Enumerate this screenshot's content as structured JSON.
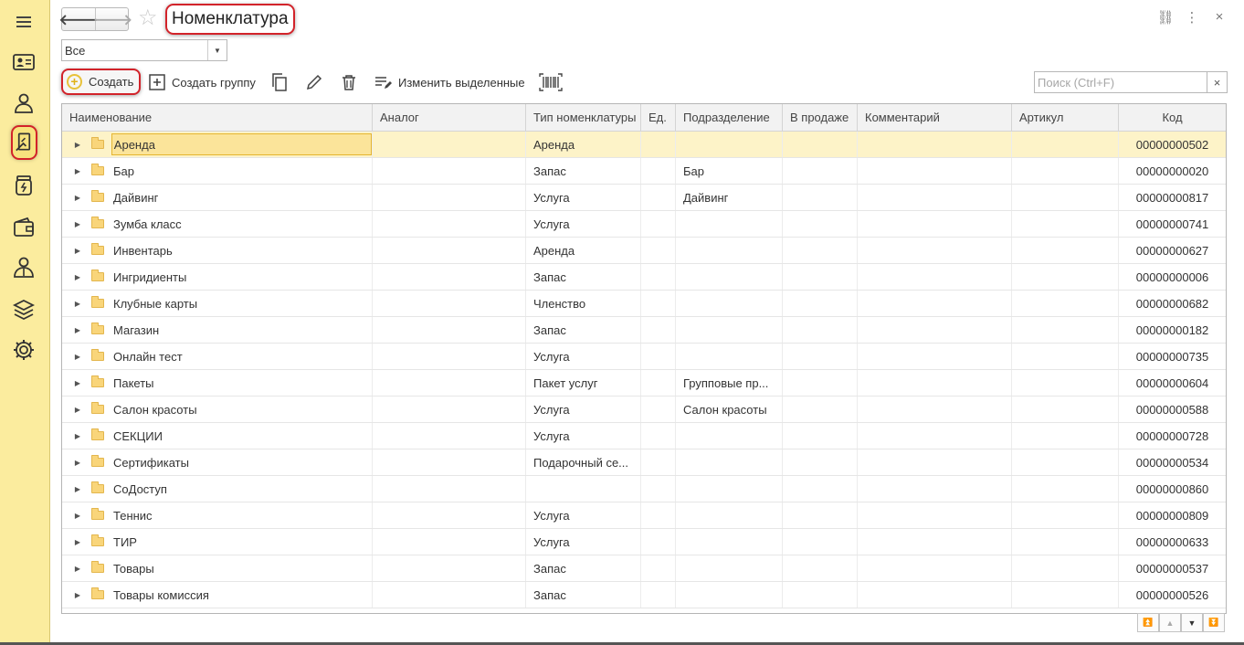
{
  "sidebar": {
    "items": [
      {
        "icon": "menu-icon"
      },
      {
        "icon": "id-card-icon"
      },
      {
        "icon": "client-icon"
      },
      {
        "icon": "nomenclature-icon"
      },
      {
        "icon": "jar-icon"
      },
      {
        "icon": "wallet-icon"
      },
      {
        "icon": "staff-icon"
      },
      {
        "icon": "layers-icon"
      },
      {
        "icon": "gear-icon"
      }
    ]
  },
  "header": {
    "back": "🡐",
    "forward": "🡒",
    "star": "☆",
    "title": "Номенклатура",
    "link_icon": "⛓",
    "more_icon": "⋮",
    "close_icon": "×"
  },
  "filter": {
    "value": "Все",
    "drop": "▼"
  },
  "toolbar": {
    "create_plus": "+",
    "create_label": "Создать",
    "create_group_label": "Создать группу",
    "edit_selected_label": "Изменить выделенные",
    "search_placeholder": "Поиск (Ctrl+F)",
    "search_clear": "×"
  },
  "table": {
    "columns": [
      "Наименование",
      "Аналог",
      "Тип номенклатуры",
      "Ед.",
      "Подразделение",
      "В продаже",
      "Комментарий",
      "Артикул",
      "Код"
    ],
    "rows": [
      {
        "name": "Аренда",
        "type": "Аренда",
        "division": "",
        "code": "00000000502"
      },
      {
        "name": "Бар",
        "type": "Запас",
        "division": "Бар",
        "code": "00000000020"
      },
      {
        "name": "Дайвинг",
        "type": "Услуга",
        "division": "Дайвинг",
        "code": "00000000817"
      },
      {
        "name": "Зумба класс",
        "type": "Услуга",
        "division": "",
        "code": "00000000741"
      },
      {
        "name": "Инвентарь",
        "type": "Аренда",
        "division": "",
        "code": "00000000627"
      },
      {
        "name": "Ингридиенты",
        "type": "Запас",
        "division": "",
        "code": "00000000006"
      },
      {
        "name": "Клубные карты",
        "type": "Членство",
        "division": "",
        "code": "00000000682"
      },
      {
        "name": "Магазин",
        "type": "Запас",
        "division": "",
        "code": "00000000182"
      },
      {
        "name": "Онлайн тест",
        "type": "Услуга",
        "division": "",
        "code": "00000000735"
      },
      {
        "name": "Пакеты",
        "type": "Пакет услуг",
        "division": "Групповые пр...",
        "code": "00000000604"
      },
      {
        "name": "Салон красоты",
        "type": "Услуга",
        "division": "Салон красоты",
        "code": "00000000588"
      },
      {
        "name": "СЕКЦИИ",
        "type": "Услуга",
        "division": "",
        "code": "00000000728"
      },
      {
        "name": "Сертификаты",
        "type": "Подарочный се...",
        "division": "",
        "code": "00000000534"
      },
      {
        "name": "СоДоступ",
        "type": "",
        "division": "",
        "code": "00000000860"
      },
      {
        "name": "Теннис",
        "type": "Услуга",
        "division": "",
        "code": "00000000809"
      },
      {
        "name": "ТИР",
        "type": "Услуга",
        "division": "",
        "code": "00000000633"
      },
      {
        "name": "Товары",
        "type": "Запас",
        "division": "",
        "code": "00000000537"
      },
      {
        "name": "Товары комиссия",
        "type": "Запас",
        "division": "",
        "code": "00000000526"
      }
    ],
    "expander": "▶"
  },
  "pager": {
    "first": "⏫",
    "up": "▲",
    "down": "▼",
    "last": "⏬"
  },
  "colors": {
    "sidebar_bg": "#fbec9e",
    "highlight": "#d2232a",
    "selected_row": "#fdf3c8"
  }
}
